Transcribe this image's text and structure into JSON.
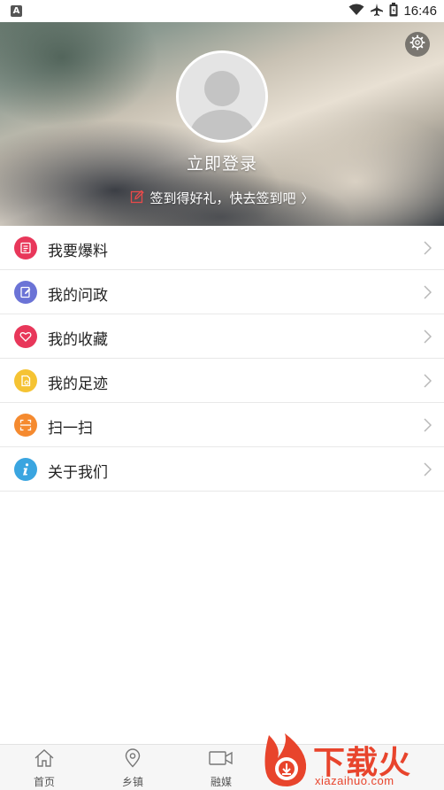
{
  "status_bar": {
    "notification_icon": "A",
    "time": "16:46",
    "icons": [
      "wifi-icon",
      "airplane-icon",
      "battery-icon"
    ]
  },
  "header": {
    "login_text": "立即登录",
    "checkin_text": "签到得好礼，快去签到吧",
    "checkin_arrow": "〉"
  },
  "menu": {
    "items": [
      {
        "label": "我要爆料",
        "icon": "report-icon",
        "color": "#e8375a"
      },
      {
        "label": "我的问政",
        "icon": "edit-doc-icon",
        "color": "#6b73d6"
      },
      {
        "label": "我的收藏",
        "icon": "heart-icon",
        "color": "#e8375a"
      },
      {
        "label": "我的足迹",
        "icon": "footprint-doc-icon",
        "color": "#f5c333"
      },
      {
        "label": "扫一扫",
        "icon": "scan-icon",
        "color": "#f58a2f"
      },
      {
        "label": "关于我们",
        "icon": "info-icon",
        "color": "#3aa5e0"
      }
    ]
  },
  "bottom_nav": {
    "items": [
      {
        "label": "首页",
        "icon": "home-icon"
      },
      {
        "label": "乡镇",
        "icon": "location-pin-icon"
      },
      {
        "label": "融媒",
        "icon": "video-camera-icon"
      }
    ]
  },
  "watermark": {
    "brand": "下载火",
    "domain": "xiazaihuo.com"
  }
}
